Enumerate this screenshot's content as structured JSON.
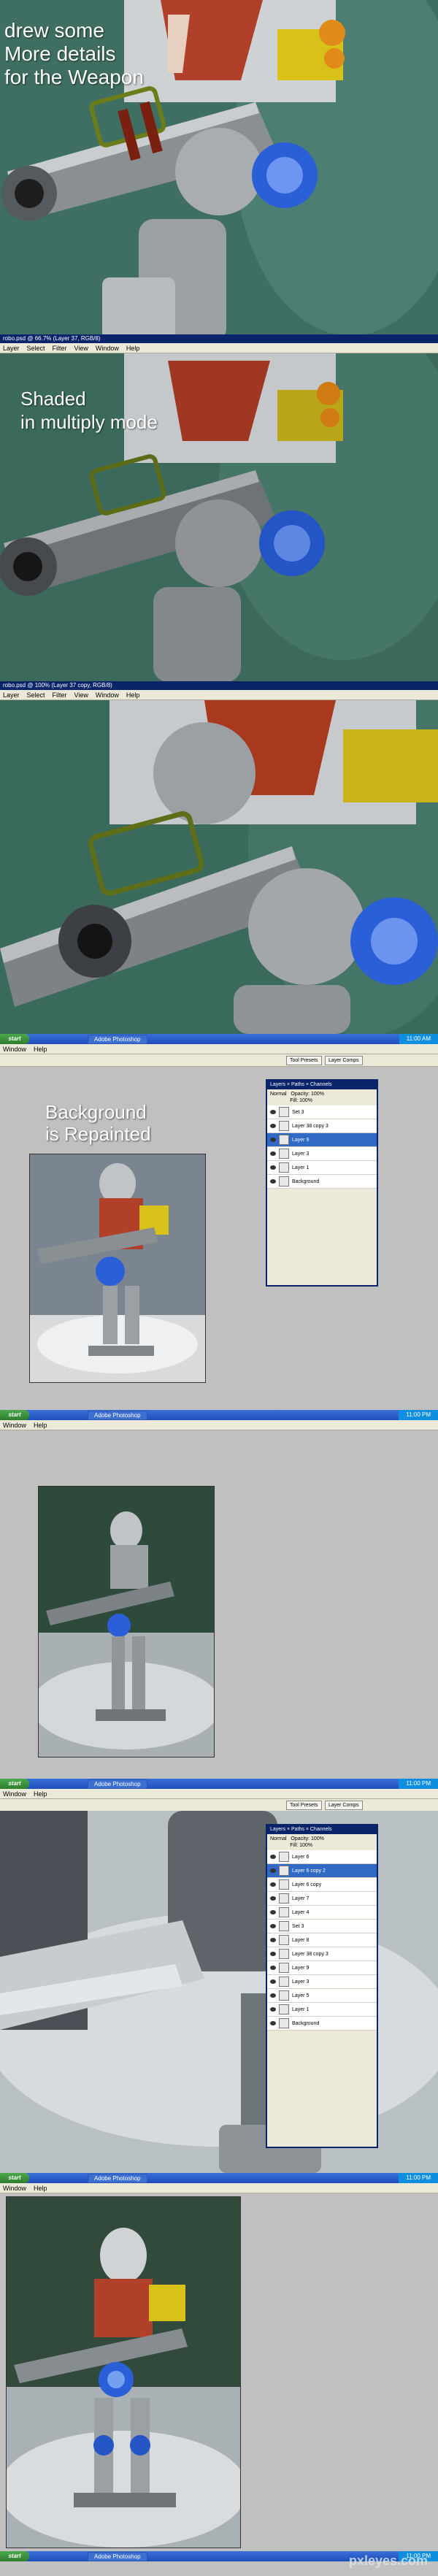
{
  "panel1": {
    "caption_lines": [
      "drew some",
      "More details",
      "for the Weapon"
    ],
    "status": "robo.psd @ 66.7% (Layer 37, RGB/8)"
  },
  "panel2": {
    "menu": [
      "Layer",
      "Select",
      "Filter",
      "View",
      "Window",
      "Help"
    ],
    "caption_lines": [
      "Shaded",
      "in multiply mode"
    ],
    "status": "robo.psd @ 100% (Layer 37 copy, RGB/8)"
  },
  "panel3": {
    "menu": [
      "Layer",
      "Select",
      "Filter",
      "View",
      "Window",
      "Help"
    ],
    "taskbar_app": "Adobe Photoshop",
    "tray_time": "11:00 AM"
  },
  "panel4": {
    "menu": [
      "Window",
      "Help"
    ],
    "caption_lines": [
      "Background",
      "is Repainted"
    ],
    "tool_presets": "Tool Presets",
    "layer_comps": "Layer Comps",
    "layers_tabs": "Layers × Paths × Channels",
    "blend_mode": "Normal",
    "opacity_label": "Opacity: 100%",
    "fill_label": "Fill: 100%",
    "layers": [
      "Set 3",
      "Layer 38 copy 3",
      "Layer 9",
      "Layer 3",
      "Layer 1",
      "Background"
    ],
    "selected_layer_index": 2,
    "taskbar_app": "Adobe Photoshop",
    "tray_time": "11:00 PM"
  },
  "panel5": {
    "menu": [
      "Window",
      "Help"
    ],
    "taskbar_app": "Adobe Photoshop",
    "tray_time": "11:00 PM"
  },
  "panel6": {
    "menu": [
      "Window",
      "Help"
    ],
    "tool_presets": "Tool Presets",
    "layer_comps": "Layer Comps",
    "layers_tabs": "Layers × Paths × Channels",
    "blend_mode": "Normal",
    "opacity_label": "Opacity: 100%",
    "fill_label": "Fill: 100%",
    "layers": [
      "Layer 6",
      "Layer 6 copy 2",
      "Layer 6 copy",
      "Layer 7",
      "Layer 4",
      "Set 3",
      "Layer 8",
      "Layer 38 copy 3",
      "Layer 9",
      "Layer 3",
      "Layer 5",
      "Layer 1",
      "Background"
    ],
    "selected_layer_index": 1,
    "taskbar_app": "Adobe Photoshop",
    "tray_time": "11:00 PM"
  },
  "panel7": {
    "menu": [
      "Window",
      "Help"
    ],
    "taskbar_app": "Adobe Photoshop",
    "tray_time": "11:00 PM"
  },
  "watermark": "pxleyes.com",
  "colors": {
    "teal_bg": "#3f6f62",
    "xp_blue": "#0a246a",
    "gray_workspace": "#c0c0c0",
    "armor_red": "#b0402a",
    "lens_blue": "#2a5fd8",
    "yellow": "#d8c21a"
  }
}
